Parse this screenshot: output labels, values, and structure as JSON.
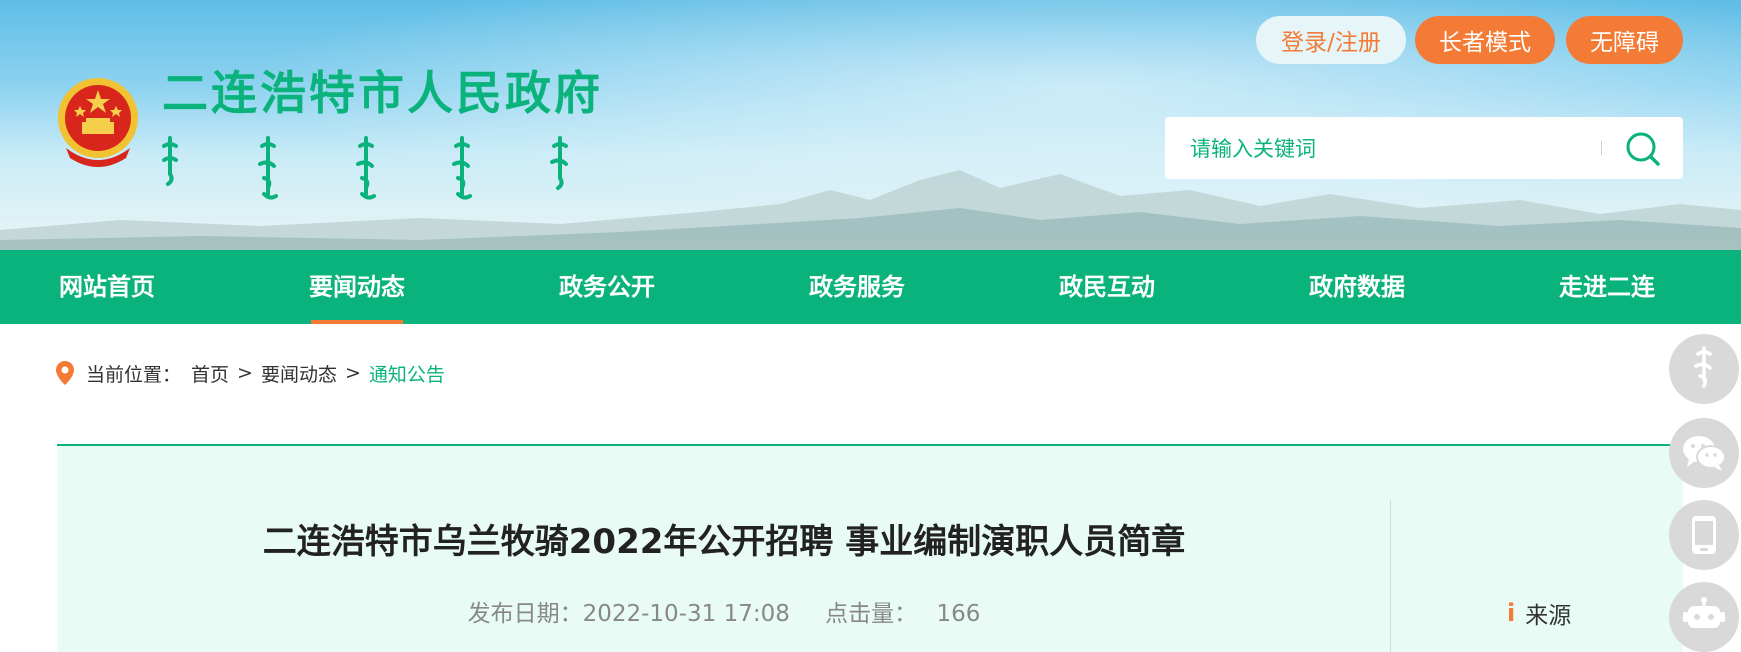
{
  "header": {
    "site_title": "二连浩特市人民政府",
    "login_label": "登录/注册",
    "elder_mode_label": "长者模式",
    "accessibility_label": "无障碍",
    "search_placeholder": "请输入关键词"
  },
  "nav": {
    "items": [
      {
        "label": "网站首页"
      },
      {
        "label": "要闻动态",
        "active": true
      },
      {
        "label": "政务公开"
      },
      {
        "label": "政务服务"
      },
      {
        "label": "政民互动"
      },
      {
        "label": "政府数据"
      },
      {
        "label": "走进二连"
      }
    ]
  },
  "breadcrumb": {
    "prefix": "当前位置：",
    "items": [
      "首页",
      "要闻动态",
      "通知公告"
    ],
    "separator": ">"
  },
  "article": {
    "title": "二连浩特市乌兰牧骑2022年公开招聘 事业编制演职人员简章",
    "date_label": "发布日期：2022-10-31 17:08",
    "clicks_label": "点击量：",
    "clicks_value": "166",
    "source_label": "来源"
  },
  "colors": {
    "brand_green": "#0bb37c",
    "accent_orange": "#f47b35"
  },
  "icons": [
    "national-emblem-icon",
    "search-icon",
    "location-pin-icon",
    "mongolian-script-icon",
    "wechat-icon",
    "mobile-icon",
    "robot-icon",
    "info-icon"
  ]
}
